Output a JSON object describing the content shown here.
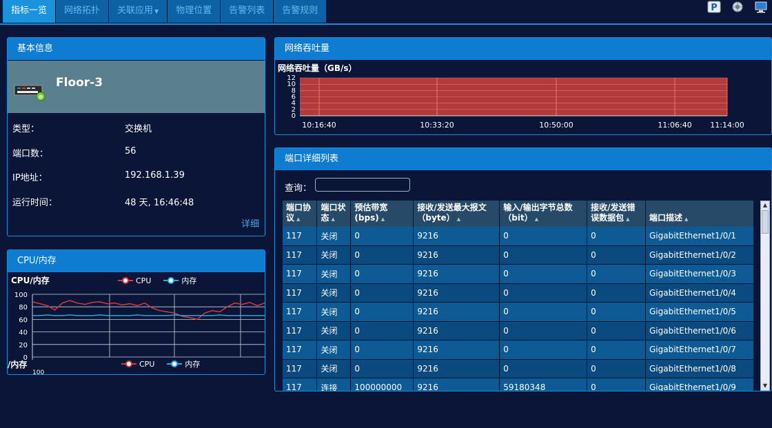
{
  "tabs": [
    {
      "label": "指标一览",
      "active": true
    },
    {
      "label": "网络拓扑",
      "active": false
    },
    {
      "label": "关联应用",
      "active": false,
      "dropdown": true
    },
    {
      "label": "物理位置",
      "active": false
    },
    {
      "label": "告警列表",
      "active": false
    },
    {
      "label": "告警规则",
      "active": false
    }
  ],
  "top_icons": [
    "parking-p-icon",
    "globe-gear-icon",
    "monitor-icon"
  ],
  "basic": {
    "title": "基本信息",
    "device_name": "Floor-3",
    "rows": [
      {
        "label": "类型：",
        "value": "交换机"
      },
      {
        "label": "端口数：",
        "value": "56"
      },
      {
        "label": "IP地址：",
        "value": "192.168.1.39"
      },
      {
        "label": "运行时间：",
        "value": "48 天, 16:46:48"
      }
    ],
    "detail_link": "详细"
  },
  "cpu": {
    "title": "CPU/内存",
    "chart_title": "CPU/内存",
    "chart_title_2": "/内存",
    "y_label_2": "100"
  },
  "throughput": {
    "title": "网络吞吐量"
  },
  "ports": {
    "title": "端口详细列表",
    "search_label": "查询：",
    "search_value": "",
    "columns": [
      {
        "line1": "端口协",
        "line2": "议"
      },
      {
        "line1": "端口状",
        "line2": "态"
      },
      {
        "line1": "",
        "line2": "预估带宽(bps)"
      },
      {
        "line1": "接收/发送最大报文",
        "line2": "（byte）"
      },
      {
        "line1": "输入/输出字节总数",
        "line2": "（bit）"
      },
      {
        "line1": "接收/发送错",
        "line2": "误数据包"
      },
      {
        "line1": "",
        "line2": "端口描述"
      }
    ],
    "rows": [
      [
        "117",
        "关闭",
        "0",
        "9216",
        "0",
        "0",
        "GigabitEthernet1/0/1"
      ],
      [
        "117",
        "关闭",
        "0",
        "9216",
        "0",
        "0",
        "GigabitEthernet1/0/2"
      ],
      [
        "117",
        "关闭",
        "0",
        "9216",
        "0",
        "0",
        "GigabitEthernet1/0/3"
      ],
      [
        "117",
        "关闭",
        "0",
        "9216",
        "0",
        "0",
        "GigabitEthernet1/0/4"
      ],
      [
        "117",
        "关闭",
        "0",
        "9216",
        "0",
        "0",
        "GigabitEthernet1/0/5"
      ],
      [
        "117",
        "关闭",
        "0",
        "9216",
        "0",
        "0",
        "GigabitEthernet1/0/6"
      ],
      [
        "117",
        "关闭",
        "0",
        "9216",
        "0",
        "0",
        "GigabitEthernet1/0/7"
      ],
      [
        "117",
        "关闭",
        "0",
        "9216",
        "0",
        "0",
        "GigabitEthernet1/0/8"
      ],
      [
        "117",
        "连接",
        "100000000",
        "9216",
        "59180348",
        "0",
        "GigabitEthernet1/0/9"
      ]
    ]
  },
  "chart_data": [
    {
      "type": "line",
      "title": "CPU/内存",
      "ylim": [
        0,
        100
      ],
      "yticks": [
        0,
        20,
        40,
        60,
        80,
        100
      ],
      "legend": [
        "CPU",
        "内存"
      ],
      "legend_placement": "top-center",
      "grid": true,
      "series": [
        {
          "name": "CPU",
          "color": "#d63a3a",
          "values": [
            88,
            85,
            82,
            75,
            86,
            90,
            86,
            84,
            87,
            88,
            85,
            86,
            83,
            85,
            82,
            86,
            78,
            74,
            72,
            70,
            65,
            63,
            60,
            70,
            74,
            72,
            80,
            86,
            84,
            87,
            82,
            86
          ]
        },
        {
          "name": "内存",
          "color": "#2aa8e0",
          "values": [
            66,
            66,
            67,
            66,
            66,
            67,
            66,
            66,
            66,
            67,
            66,
            66,
            66,
            66,
            67,
            66,
            66,
            66,
            66,
            67,
            66,
            66,
            66,
            66,
            66,
            67,
            66,
            66,
            66,
            66,
            66,
            66
          ]
        }
      ]
    },
    {
      "type": "area",
      "title": "网络吞吐量（GB/s）",
      "ylim": [
        0,
        12
      ],
      "yticks": [
        0,
        2,
        4,
        6,
        8,
        10,
        12
      ],
      "categories": [
        "10:16:40",
        "10:33:20",
        "10:50:00",
        "11:06:40",
        "11:14:00"
      ],
      "grid": true,
      "series": [
        {
          "name": "",
          "color": "#b23a3a",
          "values": [
            12,
            12,
            12,
            12,
            12
          ]
        }
      ]
    }
  ]
}
